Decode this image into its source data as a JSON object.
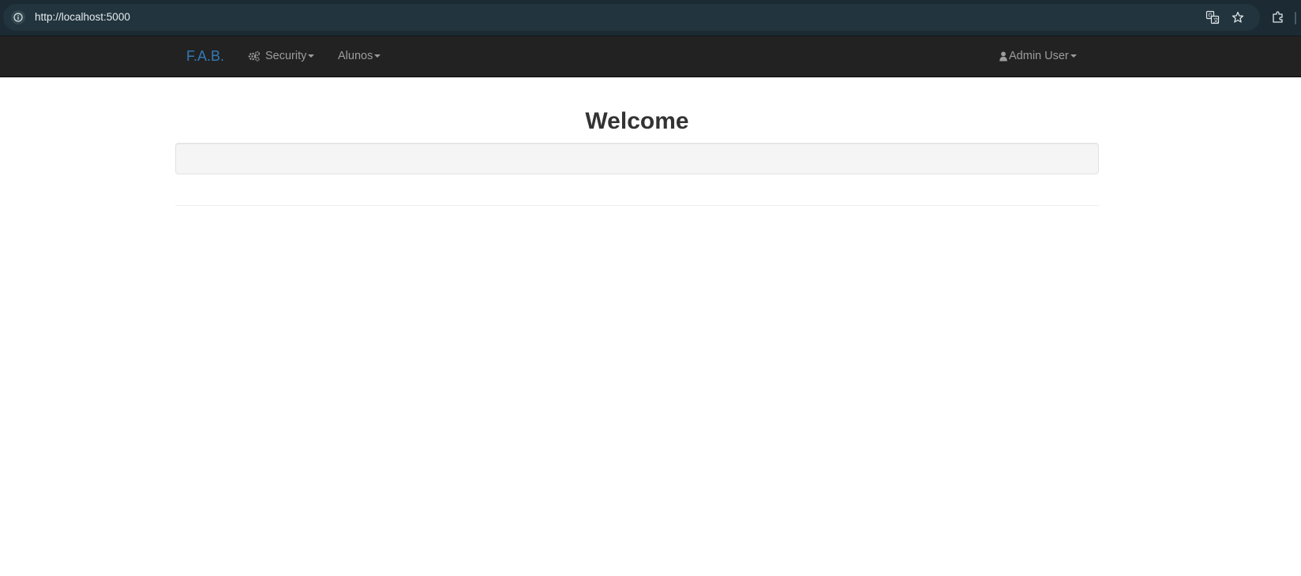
{
  "browser": {
    "url": "http://localhost:5000",
    "icons": [
      "info-icon",
      "translate-icon",
      "star-icon",
      "extensions-icon"
    ]
  },
  "navbar": {
    "brand": "F.A.B.",
    "items": [
      {
        "label": "Security",
        "icon": "cogs-icon"
      },
      {
        "label": "Alunos"
      }
    ],
    "user": {
      "label": "Admin User",
      "icon": "user-icon"
    },
    "colors": {
      "background": "#222222",
      "brand": "#337ab7",
      "link": "#9d9d9d"
    }
  },
  "main": {
    "title": "Welcome"
  }
}
